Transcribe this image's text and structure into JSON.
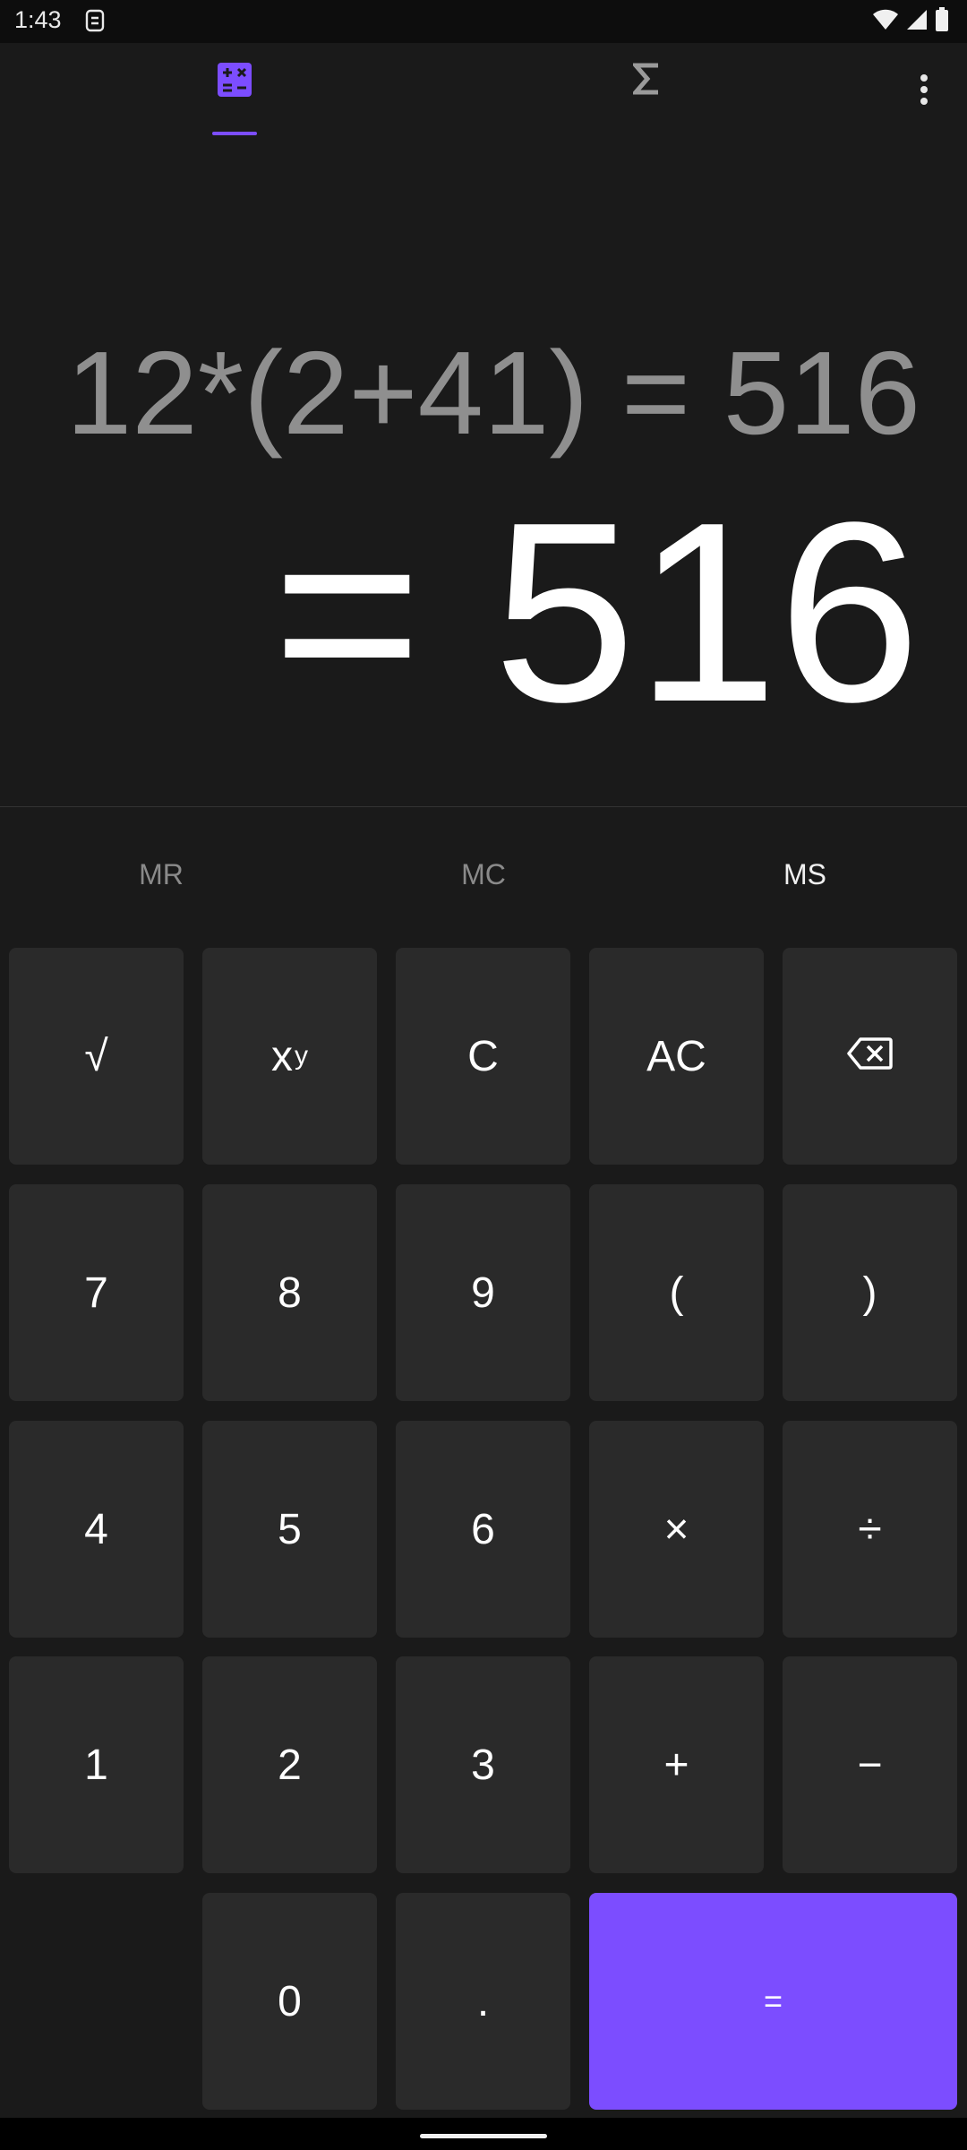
{
  "status_bar": {
    "time": "1:43"
  },
  "tabs": {
    "calculator_icon": "calculator-icon",
    "sigma_label": "Σ"
  },
  "display": {
    "expression": "12*(2+41) = 516",
    "result": "= 516"
  },
  "memory": {
    "mr": "MR",
    "mc": "MC",
    "ms": "MS"
  },
  "keys": {
    "sqrt": "√",
    "power_base": "x",
    "power_exp": "y",
    "clear": "C",
    "all_clear": "AC",
    "seven": "7",
    "eight": "8",
    "nine": "9",
    "open_paren": "(",
    "close_paren": ")",
    "four": "4",
    "five": "5",
    "six": "6",
    "multiply": "×",
    "divide": "÷",
    "one": "1",
    "two": "2",
    "three": "3",
    "plus": "+",
    "minus": "−",
    "zero": "0",
    "decimal": ".",
    "equals": "="
  },
  "colors": {
    "accent": "#7c4dff",
    "background": "#1a1a1a",
    "key": "#2a2a2a"
  }
}
